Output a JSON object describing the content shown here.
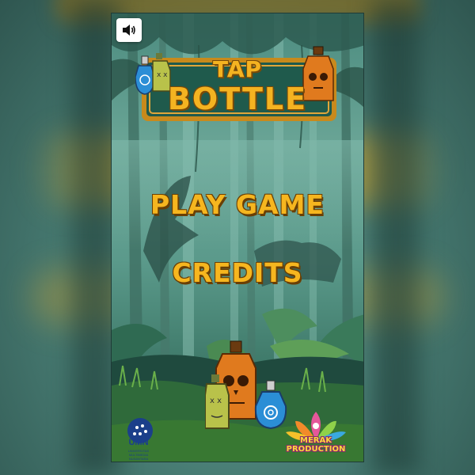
{
  "game": {
    "title_line1": "TAP",
    "title_line2": "BOTTLE"
  },
  "menu": {
    "play_label": "PLAY GAME",
    "credits_label": "CREDITS"
  },
  "sound": {
    "icon": "speaker-icon",
    "state": "on"
  },
  "sponsors": {
    "umn_name": "UMN",
    "umn_subtitle": "UNIVERSITAS MULTIMEDIA NUSANTARA",
    "studio_line1": "MERAK",
    "studio_line2": "PRODUCTION"
  },
  "colors": {
    "menu_text": "#f6b61f",
    "menu_outline": "#6a3f05",
    "logo_board": "#1f5a4c",
    "logo_frame": "#c88a1c"
  }
}
